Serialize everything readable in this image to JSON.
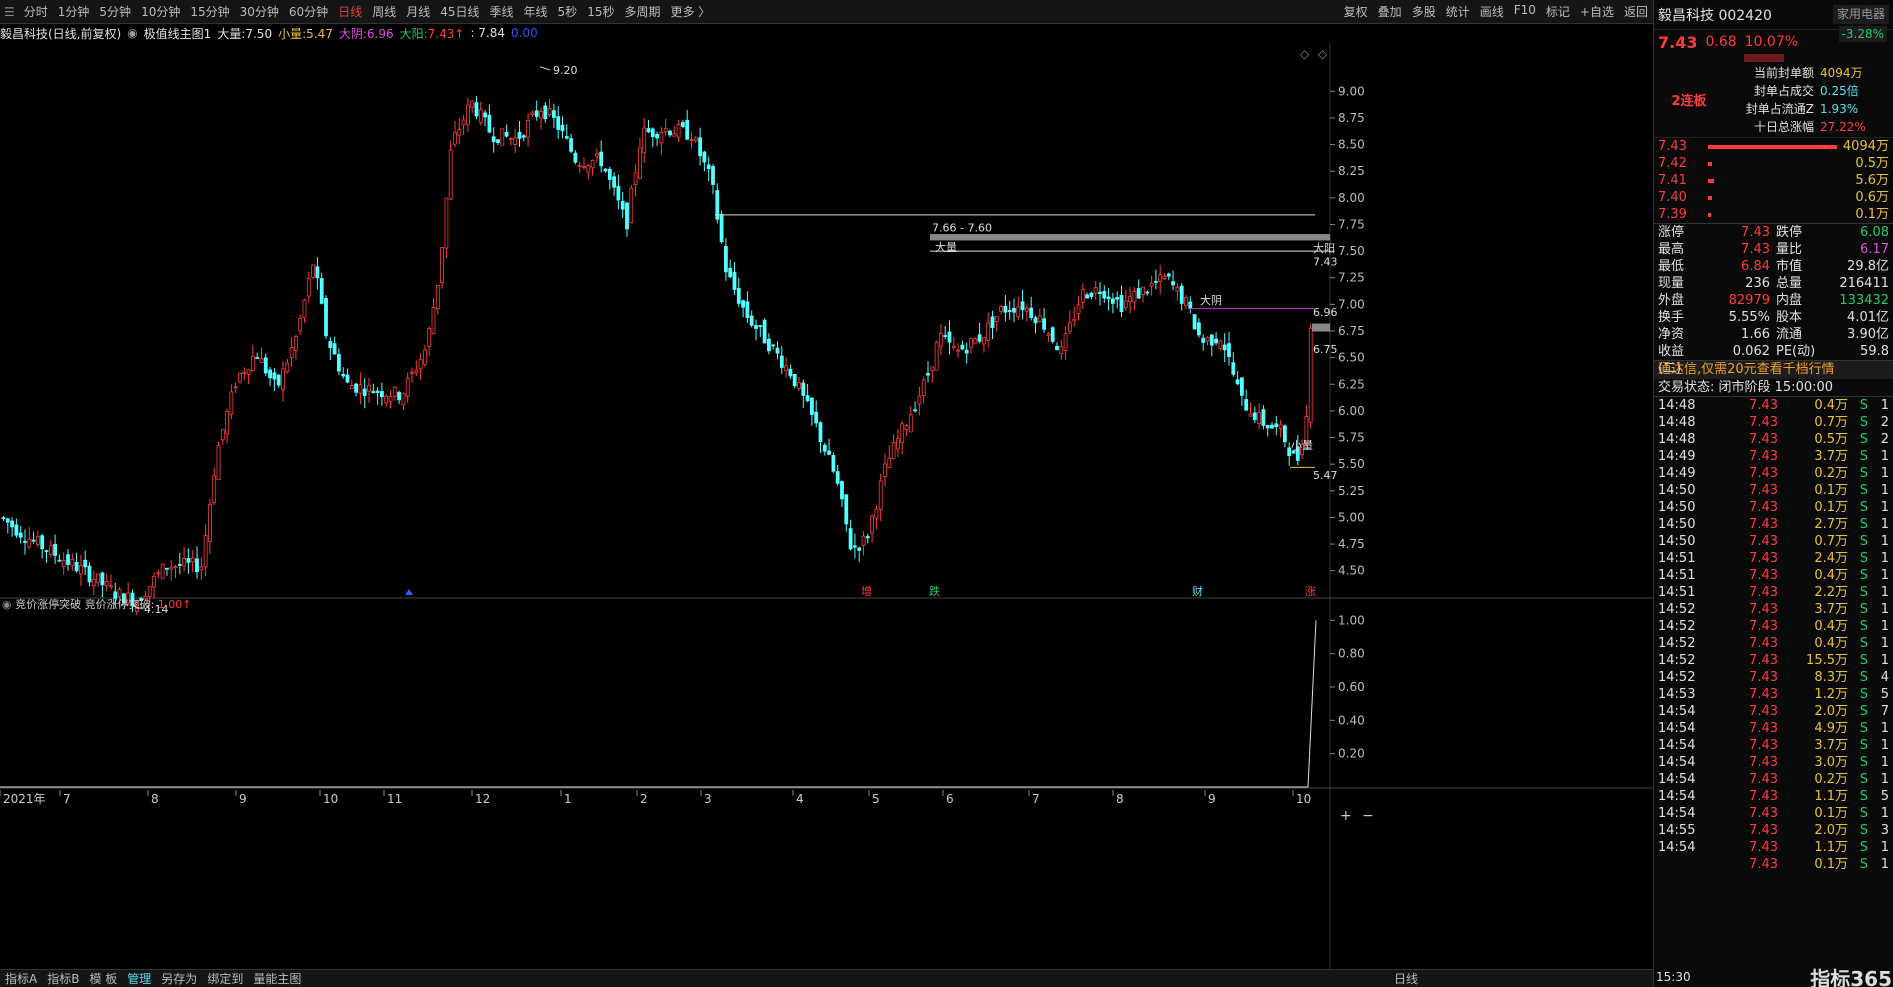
{
  "toolbar": {
    "items": [
      "分时",
      "1分钟",
      "5分钟",
      "10分钟",
      "15分钟",
      "30分钟",
      "60分钟",
      "日线",
      "周线",
      "月线",
      "45日线",
      "季线",
      "年线",
      "5秒",
      "15秒",
      "多周期",
      "更多 〉"
    ],
    "active": "日线",
    "right_items": [
      "复权",
      "叠加",
      "多股",
      "统计",
      "画线",
      "F10",
      "标记",
      "+自选",
      "返回"
    ]
  },
  "legend": {
    "stock_title": "毅昌科技(日线,前复权)",
    "indicator_name": "极值线主图1",
    "big_vol_label": "大量:",
    "big_vol": "7.50",
    "small_vol_label": "小量:",
    "small_vol": "5.47",
    "big_yin_label": "大阴:",
    "big_yin": "6.96",
    "big_yang_label": "大阳:",
    "big_yang": "7.43↑",
    "last_label": ": 7.84",
    "last2": "0.00"
  },
  "sub_legend": {
    "name": "竞价涨停突破",
    "value_label": "竞价涨停突破:",
    "value": "1.00↑"
  },
  "chart_data": {
    "type": "candlestick",
    "title": "毅昌科技(日线,前复权)",
    "y_ticks": [
      "9.00",
      "8.75",
      "8.50",
      "8.25",
      "8.00",
      "7.75",
      "7.50",
      "7.25",
      "7.00",
      "6.75",
      "6.50",
      "6.25",
      "6.00",
      "5.75",
      "5.50",
      "5.25",
      "5.00",
      "4.75",
      "4.50"
    ],
    "ylim": [
      4.3,
      9.35
    ],
    "x_labels": [
      "2021年",
      "7",
      "8",
      "9",
      "10",
      "11",
      "12",
      "1",
      "2",
      "3",
      "4",
      "5",
      "6",
      "7",
      "8",
      "9",
      "10"
    ],
    "annotations": [
      "9.20",
      "4.14",
      "7.66 - 7.60",
      "大量",
      "大阴",
      "小量",
      "大阳",
      "7.43",
      "6.96",
      "6.75",
      "5.47"
    ],
    "event_marks": [
      "增",
      "跌",
      "财",
      "涨"
    ],
    "sub_ticks": [
      "1.00",
      "0.80",
      "0.60",
      "0.40",
      "0.20"
    ],
    "sub_ylim": [
      0,
      1.05
    ],
    "high": 9.2,
    "low": 4.14,
    "last": 7.43
  },
  "bottom": {
    "items": [
      "指标A",
      "指标B",
      "模 板",
      "管理",
      "另存为",
      "绑定到",
      "量能主图"
    ],
    "active": "管理",
    "period_btn": "日线"
  },
  "panel": {
    "name": "毅昌科技",
    "code": "002420",
    "sector": "家用电器",
    "sector_pct": "-3.28%",
    "price": "7.43",
    "change": "0.68",
    "pct": "10.07%",
    "streak": "2连板",
    "seal_rows": [
      {
        "label": "当前封单额",
        "value": "4094万"
      },
      {
        "label": "封单占成交",
        "value": "0.25倍"
      },
      {
        "label": "封单占流通Z",
        "value": "1.93%"
      },
      {
        "label": "十日总涨幅",
        "value": "27.22%"
      }
    ],
    "book": [
      {
        "p": "7.43",
        "v": "4094万"
      },
      {
        "p": "7.42",
        "v": "0.5万"
      },
      {
        "p": "7.41",
        "v": "5.6万"
      },
      {
        "p": "7.40",
        "v": "0.6万"
      },
      {
        "p": "7.39",
        "v": "0.1万"
      }
    ],
    "stats": [
      [
        "涨停",
        "7.43",
        "跌停",
        "6.08"
      ],
      [
        "最高",
        "7.43",
        "量比",
        "6.17"
      ],
      [
        "最低",
        "6.84",
        "市值",
        "29.8亿"
      ],
      [
        "现量",
        "236",
        "总量",
        "216411"
      ],
      [
        "外盘",
        "82979",
        "内盘",
        "133432"
      ],
      [
        "换手",
        "5.55%",
        "股本",
        "4.01亿"
      ],
      [
        "净资",
        "1.66",
        "流通",
        "3.90亿"
      ],
      [
        "收益(二)",
        "0.062",
        "PE(动)",
        "59.8"
      ]
    ],
    "notice": "通达信,仅需20元查看千档行情",
    "trade_state": "交易状态: 闭市阶段 15:00:00",
    "ticks": [
      [
        "14:48",
        "7.43",
        "0.4万",
        "S",
        "1"
      ],
      [
        "14:48",
        "7.43",
        "0.7万",
        "S",
        "2"
      ],
      [
        "14:48",
        "7.43",
        "0.5万",
        "S",
        "2"
      ],
      [
        "14:49",
        "7.43",
        "3.7万",
        "S",
        "1"
      ],
      [
        "14:49",
        "7.43",
        "0.2万",
        "S",
        "1"
      ],
      [
        "14:50",
        "7.43",
        "0.1万",
        "S",
        "1"
      ],
      [
        "14:50",
        "7.43",
        "0.1万",
        "S",
        "1"
      ],
      [
        "14:50",
        "7.43",
        "2.7万",
        "S",
        "1"
      ],
      [
        "14:50",
        "7.43",
        "0.7万",
        "S",
        "1"
      ],
      [
        "14:51",
        "7.43",
        "2.4万",
        "S",
        "1"
      ],
      [
        "14:51",
        "7.43",
        "0.4万",
        "S",
        "1"
      ],
      [
        "14:51",
        "7.43",
        "2.2万",
        "S",
        "1"
      ],
      [
        "14:52",
        "7.43",
        "3.7万",
        "S",
        "1"
      ],
      [
        "14:52",
        "7.43",
        "0.4万",
        "S",
        "1"
      ],
      [
        "14:52",
        "7.43",
        "0.4万",
        "S",
        "1"
      ],
      [
        "14:52",
        "7.43",
        "15.5万",
        "S",
        "1"
      ],
      [
        "14:52",
        "7.43",
        "8.3万",
        "S",
        "4"
      ],
      [
        "14:53",
        "7.43",
        "1.2万",
        "S",
        "5"
      ],
      [
        "14:54",
        "7.43",
        "2.0万",
        "S",
        "7"
      ],
      [
        "14:54",
        "7.43",
        "4.9万",
        "S",
        "1"
      ],
      [
        "14:54",
        "7.43",
        "3.7万",
        "S",
        "1"
      ],
      [
        "14:54",
        "7.43",
        "3.0万",
        "S",
        "1"
      ],
      [
        "14:54",
        "7.43",
        "0.2万",
        "S",
        "1"
      ],
      [
        "14:54",
        "7.43",
        "1.1万",
        "S",
        "5"
      ],
      [
        "14:54",
        "7.43",
        "0.1万",
        "S",
        "1"
      ],
      [
        "14:55",
        "7.43",
        "2.0万",
        "S",
        "3"
      ],
      [
        "14:54",
        "7.43",
        "1.1万",
        "S",
        "1"
      ],
      [
        "",
        "7.43",
        "0.1万",
        "S",
        "1"
      ]
    ],
    "footer_time": "15:30",
    "watermark": "指标365"
  }
}
